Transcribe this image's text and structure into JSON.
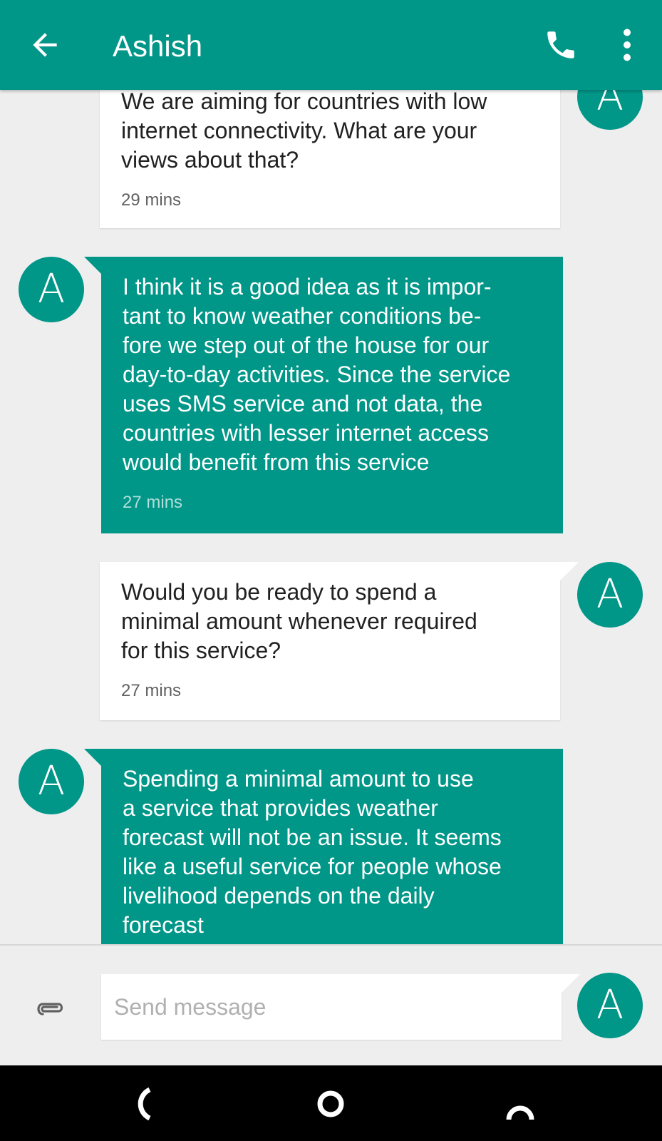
{
  "header": {
    "contact_name": "Ashish",
    "back_icon": "arrow-left-icon",
    "call_icon": "phone-icon",
    "menu_icon": "more-vertical-icon"
  },
  "messages": [
    {
      "direction": "incoming",
      "text": "We are aiming for countries with low\ninternet connectivity. What are your\nviews about that?",
      "time": "29 mins",
      "avatar": "A"
    },
    {
      "direction": "outgoing",
      "text": "I think it is a good idea as it is impor-\ntant to know weather conditions be-\nfore we step out of the house for our\nday-to-day activities. Since the service\nuses SMS service and not data, the\ncountries with lesser internet access\nwould benefit from this service",
      "time": "27 mins",
      "avatar": "A"
    },
    {
      "direction": "incoming",
      "text": "Would you be ready to spend a\nminimal amount whenever required\nfor this service?",
      "time": "27 mins",
      "avatar": "A"
    },
    {
      "direction": "outgoing",
      "text": "Spending a minimal amount to use\na service that provides weather\nforecast will not be an issue. It seems\nlike a useful service for people whose\nlivelihood depends on the daily\nforecast",
      "avatar": "A"
    }
  ],
  "composer": {
    "placeholder": "Send message",
    "attach_icon": "paperclip-icon",
    "send_avatar": "A"
  },
  "navbar": {
    "back_icon": "nav-back-icon",
    "home_icon": "nav-home-icon",
    "recents_icon": "nav-recents-icon"
  },
  "colors": {
    "primary": "#009688",
    "background": "#eeeeee",
    "incoming_bubble": "#ffffff",
    "outgoing_bubble": "#009688"
  }
}
